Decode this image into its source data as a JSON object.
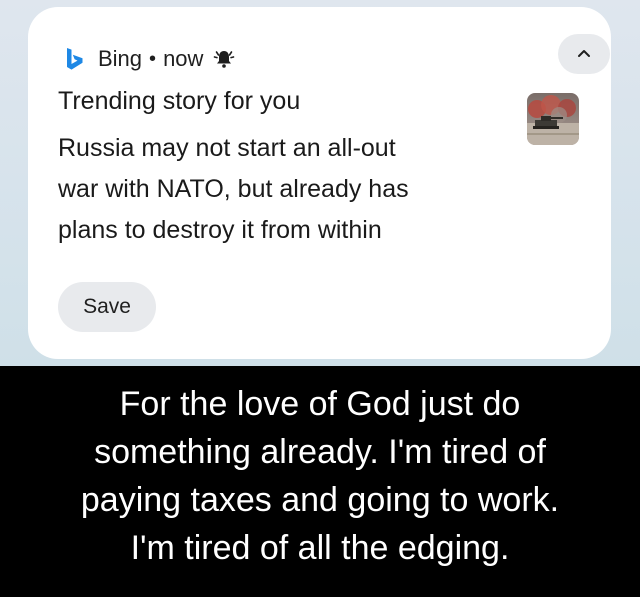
{
  "notification": {
    "app_name": "Bing",
    "separator": "•",
    "time": "now",
    "icons": {
      "app": "bing-logo-icon",
      "alert": "bell-alert-icon",
      "collapse": "chevron-up-icon",
      "thumbnail": "news-photo-thumbnail"
    },
    "title": "Trending story for you",
    "body_lines": [
      "Russia may not start an all-out",
      "war with NATO, but already has",
      "plans to destroy it from within"
    ],
    "save_label": "Save"
  },
  "caption": {
    "lines": [
      "For the love of God just do",
      "something already. I'm tired of",
      "paying taxes and going to work.",
      "I'm tired of all the edging."
    ]
  },
  "colors": {
    "bing_accent": "#1e88e5",
    "card_background": "#ffffff",
    "pill_background": "#e8eaed",
    "caption_background": "#000000",
    "caption_text": "#ffffff"
  }
}
